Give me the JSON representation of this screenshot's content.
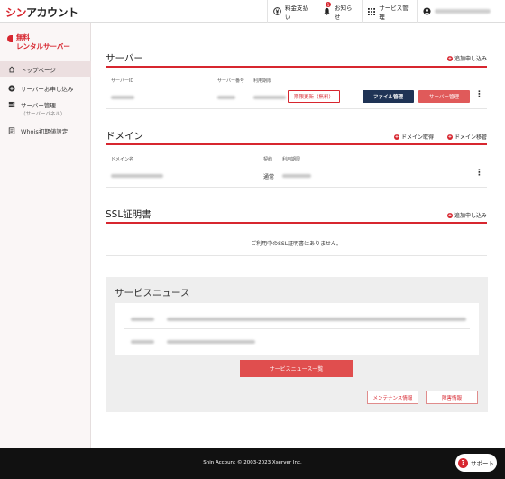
{
  "header": {
    "logo_red": "シン",
    "logo_dark": "アカウント",
    "payment_label": "料金支払い",
    "notifications_label": "お知らせ",
    "notifications_count": "1",
    "service_mgmt_label": "サービス管理"
  },
  "sidebar": {
    "brand_line1": "無料",
    "brand_line2": "レンタルサーバー",
    "items": [
      {
        "label": "トップページ",
        "sub": ""
      },
      {
        "label": "サーバーお申し込み",
        "sub": ""
      },
      {
        "label": "サーバー管理",
        "sub": "（サーバーパネル）"
      },
      {
        "label": "Whois初期値設定",
        "sub": ""
      }
    ]
  },
  "server": {
    "title": "サーバー",
    "add_link": "追加申し込み",
    "columns": [
      "サーバーID",
      "サーバー番号",
      "利用期限"
    ],
    "renew_button": "期限更新（無料）",
    "file_manager_button": "ファイル管理",
    "server_manager_button": "サーバー管理"
  },
  "domain": {
    "title": "ドメイン",
    "acquire_link": "ドメイン取得",
    "transfer_link": "ドメイン移管",
    "columns": [
      "ドメイン名",
      "契約",
      "利用期限"
    ],
    "contract_value": "通常"
  },
  "ssl": {
    "title": "SSL証明書",
    "add_link": "追加申し込み",
    "empty_message": "ご利用中のSSL証明書はありません。"
  },
  "news": {
    "title": "サービスニュース",
    "list_button": "サービスニュース一覧",
    "maintenance_button": "メンテナンス情報",
    "failure_button": "障害情報"
  },
  "footer": {
    "copyright": "Shin Account © 2003-2023 Xserver Inc.",
    "support_label": "サポート"
  },
  "colors": {
    "accent": "#d7262f",
    "navy": "#1f3355",
    "footer": "#111111"
  }
}
